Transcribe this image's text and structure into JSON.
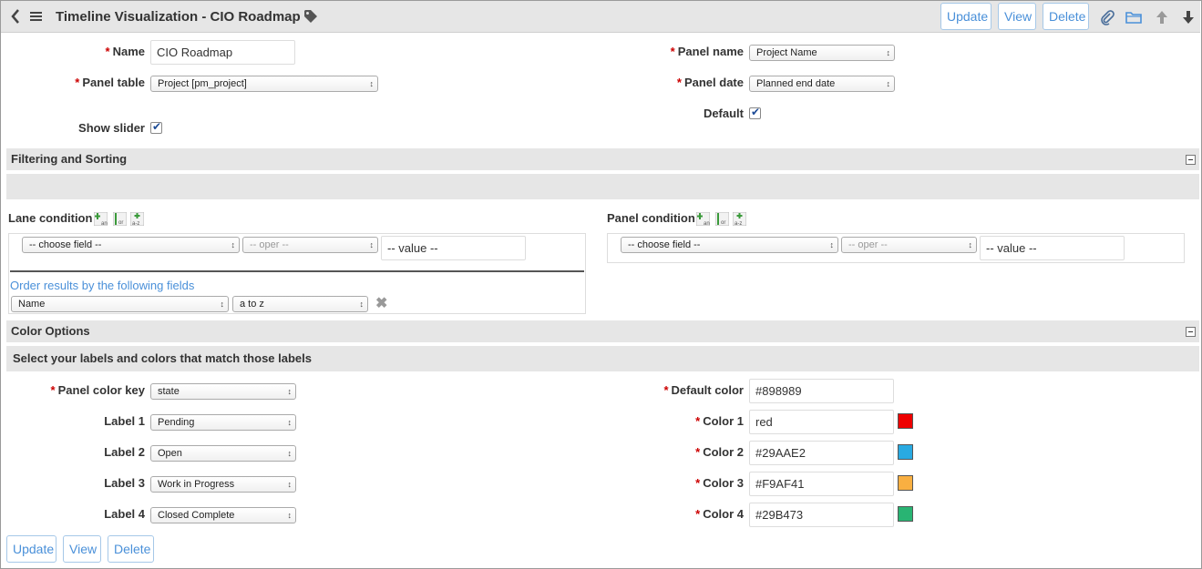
{
  "header": {
    "title": "Timeline Visualization - CIO Roadmap",
    "buttons": {
      "update": "Update",
      "view": "View",
      "delete": "Delete"
    }
  },
  "form": {
    "name": {
      "label": "Name",
      "value": "CIO Roadmap"
    },
    "panel_table": {
      "label": "Panel table",
      "value": "Project [pm_project]"
    },
    "show_slider": {
      "label": "Show slider",
      "checked": true
    },
    "panel_name": {
      "label": "Panel name",
      "value": "Project Name"
    },
    "panel_date": {
      "label": "Panel date",
      "value": "Planned end date"
    },
    "default": {
      "label": "Default",
      "checked": true
    }
  },
  "filtering": {
    "title": "Filtering and Sorting",
    "lane_condition": {
      "label": "Lane condition",
      "field": "-- choose field --",
      "oper": "-- oper --",
      "value": "-- value --"
    },
    "panel_condition": {
      "label": "Panel condition",
      "field": "-- choose field --",
      "oper": "-- oper --",
      "value": "-- value --"
    },
    "order": {
      "label": "Order results by the following fields",
      "field": "Name",
      "direction": "a to z"
    },
    "cond_buttons": {
      "and": "and",
      "or": "or",
      "sort": "a-z"
    }
  },
  "color_options": {
    "title": "Color Options",
    "subtitle": "Select your labels and colors that match those labels",
    "panel_color_key": {
      "label": "Panel color key",
      "value": "state"
    },
    "labels": [
      {
        "label": "Label 1",
        "value": "Pending"
      },
      {
        "label": "Label 2",
        "value": "Open"
      },
      {
        "label": "Label 3",
        "value": "Work in Progress"
      },
      {
        "label": "Label 4",
        "value": "Closed Complete"
      }
    ],
    "default_color": {
      "label": "Default color",
      "value": "#898989"
    },
    "colors": [
      {
        "label": "Color 1",
        "value": "red",
        "swatch": "#ee0000"
      },
      {
        "label": "Color 2",
        "value": "#29AAE2",
        "swatch": "#29AAE2"
      },
      {
        "label": "Color 3",
        "value": "#F9AF41",
        "swatch": "#F9AF41"
      },
      {
        "label": "Color 4",
        "value": "#29B473",
        "swatch": "#29B473"
      }
    ]
  },
  "footer": {
    "update": "Update",
    "view": "View",
    "delete": "Delete"
  },
  "icons": [
    "back-icon",
    "menu-icon",
    "tag-icon",
    "paperclip-icon",
    "folder-icon",
    "arrow-up-icon",
    "arrow-down-icon",
    "add-and-icon",
    "add-or-icon",
    "sort-icon",
    "close-icon"
  ]
}
